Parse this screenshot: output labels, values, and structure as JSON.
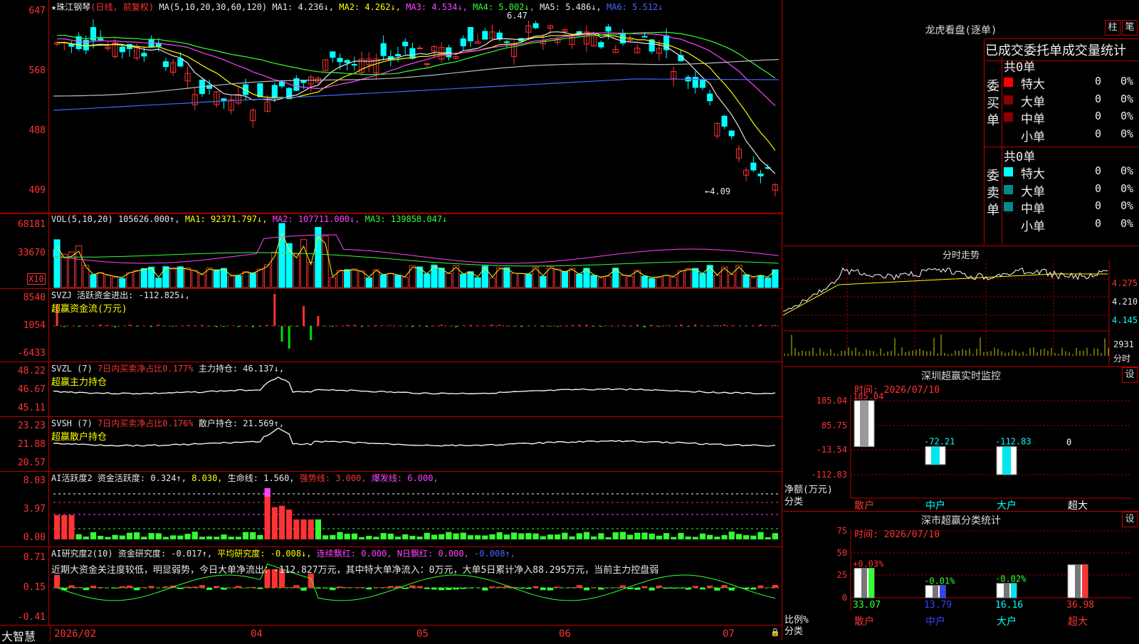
{
  "colors": {
    "up": "#ff3333",
    "down": "#00ffff",
    "ma1": "#e8e8e8",
    "ma2": "#ffff00",
    "ma3": "#ff44ff",
    "ma4": "#33ff33",
    "ma5": "#4466ff",
    "grid": "#b00000"
  },
  "main": {
    "title": "★珠江钢琴",
    "mode": "(日线, 前复权)",
    "ma_params": "MA(5,10,20,30,60,120)",
    "ma1": "MA1: 4.236↓,",
    "ma2": "MA2: 4.262↓,",
    "ma3": "MA3: 4.534↓,",
    "ma4": "MA4: 5.002↓,",
    "ma5": "MA5: 5.486↓,",
    "ma6": "MA6: 5.512↓",
    "ticks": [
      "647",
      "568",
      "488",
      "409"
    ],
    "high_label": "6.47",
    "low_label": "←4.09"
  },
  "vol": {
    "header": "VOL(5,10,20)",
    "value": "105626.000↑,",
    "ma1": "MA1: 92371.797↓,",
    "ma2": "MA2: 107711.000↓,",
    "ma3": "MA3: 139858.047↓",
    "ticks": [
      "68181",
      "33670"
    ],
    "unit": "X10"
  },
  "svzj": {
    "header": "SVZJ 活跃资金进出: -112.825↓,",
    "sub": "超赢资金流(万元)",
    "ticks": [
      "8540",
      "1054",
      "-6433"
    ]
  },
  "svzl": {
    "header": "SVZL (7)",
    "pct": "7日内买卖净占比0.177%",
    "hold": "主力持仓: 46.137↓,",
    "sub": "超赢主力持仓",
    "ticks": [
      "48.22",
      "46.67",
      "45.11"
    ]
  },
  "svsh": {
    "header": "SVSH (7)",
    "pct": "7日内买卖净占比0.176%",
    "hold": "散户持仓: 21.569↑,",
    "sub": "超赢散户持仓",
    "ticks": [
      "23.23",
      "21.88",
      "20.57"
    ]
  },
  "ai1": {
    "name": "AI活跃度2",
    "a": "资金活跃度: 0.324↑,",
    "b": "8.030,",
    "c": "生命线: 1.560,",
    "d": "强势线: 3.000,",
    "e": "爆发线: 6.000,",
    "ticks": [
      "8.03",
      "3.97",
      "0.00"
    ]
  },
  "ai2": {
    "name": "AI研究度2(10)",
    "a": "资金研究度: -0.017↑,",
    "b": "平均研究度: -0.008↓,",
    "c": "连续飘红: 0.000,",
    "d": "N日飘红: 0.000,",
    "e": "-0.008↑,",
    "note": "近期大资金关注度较低，明显弱势，今日大单净流出：-112.827万元，其中特大单净流入：0万元，大单5日累计净入88.295万元，当前主力控盘弱",
    "ticks": [
      "0.71",
      "0.15",
      "-0.41"
    ]
  },
  "xaxis": {
    "logo": "大智慧",
    "labels": [
      "2026/02",
      "04",
      "05",
      "06",
      "07"
    ]
  },
  "dragon": {
    "title": "龙虎看盘(逐单)",
    "btn1": "柱",
    "btn2": "笔",
    "heading": "已成交委托单成交量统计",
    "buy_label": "委买单",
    "sell_label": "委卖单",
    "buy_total": "共0单",
    "sell_total": "共0单",
    "rows": [
      {
        "name": "特大",
        "val": "0",
        "pct": "0%"
      },
      {
        "name": "大单",
        "val": "0",
        "pct": "0%"
      },
      {
        "name": "中单",
        "val": "0",
        "pct": "0%"
      },
      {
        "name": "小单",
        "val": "0",
        "pct": "0%"
      }
    ]
  },
  "minute": {
    "title": "分时走势",
    "p1": "4.275",
    "p2": "4.210",
    "p3": "4.145",
    "vol": "2931",
    "unit": "分时"
  },
  "monitor": {
    "title": "深圳超赢实时监控",
    "btn": "设",
    "time": "时间: 2026/07/10",
    "ticks": [
      "185.04",
      "85.75",
      "-13.54",
      "-112.83"
    ],
    "ylabel": "净额(万元)",
    "xlabel": "分类",
    "cats": [
      {
        "name": "散户",
        "value": 185.04,
        "label": "185.04"
      },
      {
        "name": "中户",
        "value": -72.21,
        "label": "-72.21"
      },
      {
        "name": "大户",
        "value": -112.83,
        "label": "-112.83"
      },
      {
        "name": "超大",
        "value": 0,
        "label": "0"
      }
    ]
  },
  "classify": {
    "title": "深市超赢分类统计",
    "btn": "设",
    "time": "时间: 2026/07/10",
    "ticks": [
      "75",
      "50",
      "25",
      "0"
    ],
    "ylabel": "比例%",
    "xlabel": "分类",
    "cats": [
      {
        "name": "散户",
        "value": 33.07,
        "label": "33.07",
        "chg": "+0.03%"
      },
      {
        "name": "中户",
        "value": 13.79,
        "label": "13.79",
        "chg": "-0.01%"
      },
      {
        "name": "大户",
        "value": 16.16,
        "label": "16.16",
        "chg": "-0.02%"
      },
      {
        "name": "超大",
        "value": 36.98,
        "label": "36.98",
        "chg": ""
      }
    ]
  }
}
